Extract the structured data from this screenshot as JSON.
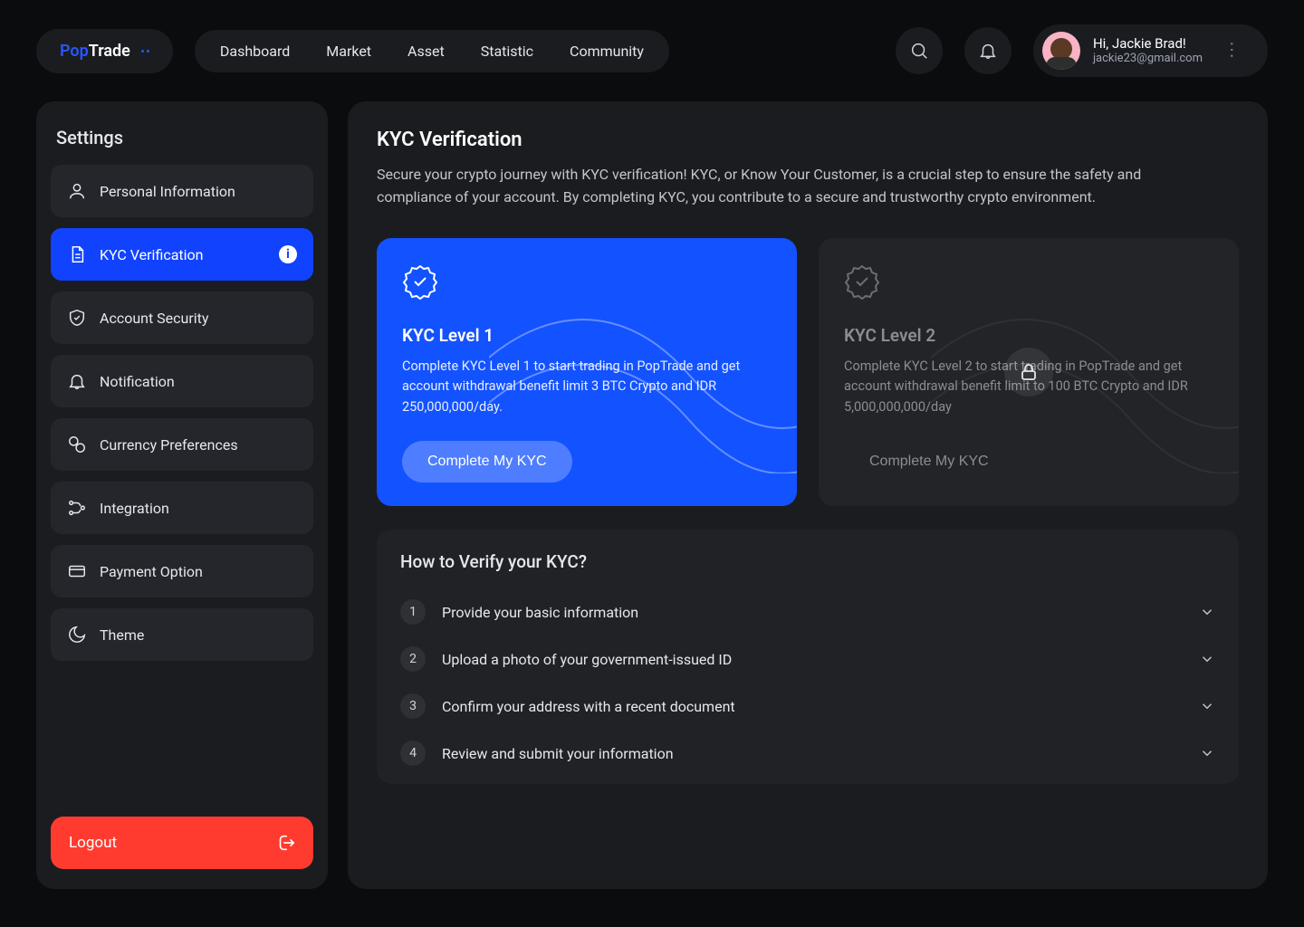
{
  "brand": {
    "pop": "Pop",
    "trade": "Trade"
  },
  "nav": {
    "dashboard": "Dashboard",
    "market": "Market",
    "asset": "Asset",
    "statistic": "Statistic",
    "community": "Community"
  },
  "user": {
    "greeting": "Hi, Jackie Brad!",
    "email": "jackie23@gmail.com"
  },
  "sidebar": {
    "title": "Settings",
    "items": {
      "personal": "Personal Information",
      "kyc": "KYC Verification",
      "security": "Account Security",
      "notify": "Notification",
      "currency": "Currency Preferences",
      "integrate": "Integration",
      "payment": "Payment Option",
      "theme": "Theme"
    },
    "logout": "Logout"
  },
  "page": {
    "title": "KYC Verification",
    "desc": "Secure your crypto journey with KYC verification! KYC, or Know Your Customer, is a crucial step to ensure the safety and compliance of your account. By completing KYC, you contribute to a secure and trustworthy crypto environment."
  },
  "kyc": {
    "level1": {
      "title": "KYC Level 1",
      "desc": "Complete KYC Level 1 to start trading in PopTrade and get account withdrawal benefit limit 3 BTC Crypto and IDR 250,000,000/day.",
      "cta": "Complete My KYC"
    },
    "level2": {
      "title": "KYC Level 2",
      "desc": "Complete KYC Level 2 to start trading in PopTrade and get account withdrawal benefit limit to 100 BTC Crypto and IDR 5,000,000,000/day",
      "cta": "Complete My KYC"
    }
  },
  "howto": {
    "title": "How to Verify your KYC?",
    "steps": {
      "s1": "Provide your basic information",
      "s2": "Upload a photo of your government-issued ID",
      "s3": "Confirm your address with a recent document",
      "s4": "Review and submit your information"
    },
    "nums": {
      "n1": "1",
      "n2": "2",
      "n3": "3",
      "n4": "4"
    }
  }
}
